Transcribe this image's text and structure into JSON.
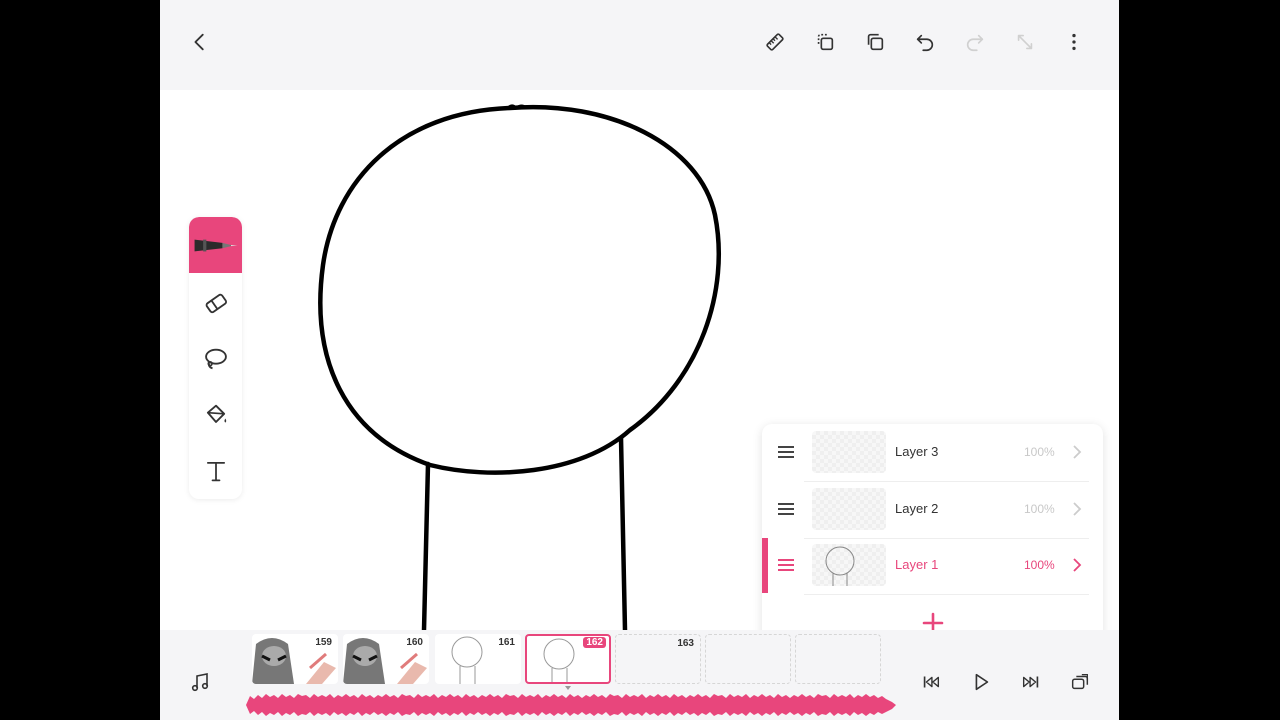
{
  "app": {
    "accent_color": "#e8467c",
    "topbar": {
      "icons": [
        "back-chevron-icon",
        "ruler-icon",
        "duplicate-frame-icon",
        "copy-icon",
        "undo-icon",
        "redo-icon",
        "resize-icon",
        "more-vertical-icon"
      ]
    },
    "tools": {
      "items": [
        "pen-tool-icon",
        "eraser-icon",
        "lasso-icon",
        "paint-bucket-icon",
        "text-icon"
      ],
      "active": "pen"
    },
    "layers": {
      "items": [
        {
          "name": "Layer 3",
          "opacity": "100%",
          "selected": false
        },
        {
          "name": "Layer 2",
          "opacity": "100%",
          "selected": false
        },
        {
          "name": "Layer 1",
          "opacity": "100%",
          "selected": true
        }
      ],
      "add_icon": "plus-icon"
    },
    "timeline": {
      "frames": [
        {
          "number": "159",
          "kind": "character"
        },
        {
          "number": "160",
          "kind": "character"
        },
        {
          "number": "161",
          "kind": "sketch"
        },
        {
          "number": "162",
          "kind": "sketch",
          "current": true
        },
        {
          "number": "163",
          "kind": "empty"
        },
        {
          "number": "",
          "kind": "empty"
        },
        {
          "number": "",
          "kind": "empty"
        }
      ],
      "playback_icons": [
        "skip-start-icon",
        "play-icon",
        "skip-end-icon",
        "layers-icon"
      ],
      "music_icon": "music-note-icon"
    }
  }
}
